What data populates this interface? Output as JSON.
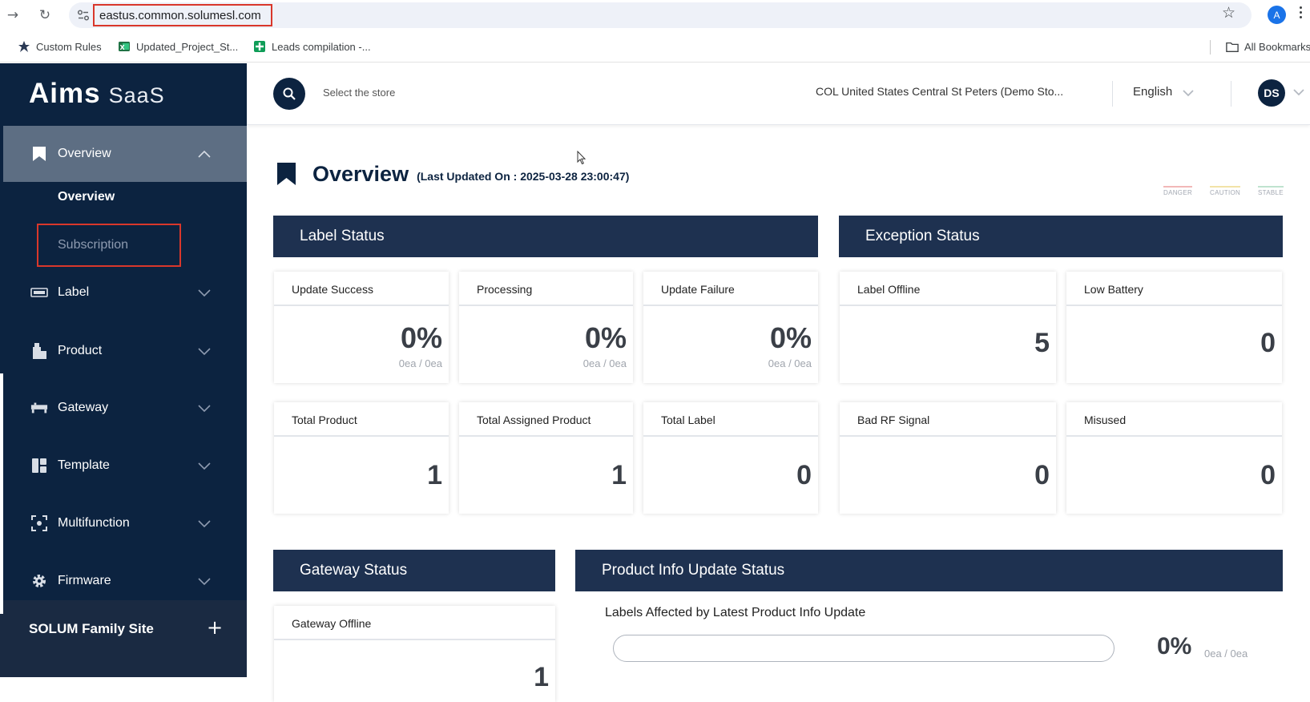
{
  "browser": {
    "url": "eastus.common.solumesl.com",
    "profile_initial": "A",
    "bookmarks": [
      {
        "label": "Custom Rules",
        "icon": "custom-rules-icon"
      },
      {
        "label": "Updated_Project_St...",
        "icon": "excel-icon"
      },
      {
        "label": "Leads compilation -...",
        "icon": "sheets-icon"
      }
    ],
    "all_bookmarks": "All Bookmarks"
  },
  "sidebar": {
    "logo_main": "Aims",
    "logo_sub": "SaaS",
    "overview_label": "Overview",
    "sub_items": [
      "Overview",
      "Subscription"
    ],
    "items": [
      {
        "label": "Label",
        "icon": "label-icon"
      },
      {
        "label": "Product",
        "icon": "product-icon"
      },
      {
        "label": "Gateway",
        "icon": "gateway-icon"
      },
      {
        "label": "Template",
        "icon": "template-icon"
      },
      {
        "label": "Multifunction",
        "icon": "multifunction-icon"
      },
      {
        "label": "Firmware",
        "icon": "gear-icon"
      }
    ],
    "family_site": "SOLUM Family Site",
    "family_plus": "+"
  },
  "header": {
    "store_placeholder": "Select the store",
    "store_name": "COL United States Central St Peters (Demo Sto...",
    "language": "English",
    "user_initials": "DS"
  },
  "page": {
    "title": "Overview",
    "last_updated": "(Last Updated On : 2025-03-28 23:00:47)",
    "legend": [
      {
        "label": "DANGER",
        "color": "#f2b8b8"
      },
      {
        "label": "CAUTION",
        "color": "#f2e3a8"
      },
      {
        "label": "STABLE",
        "color": "#bfe3cf"
      }
    ]
  },
  "label_status": {
    "title": "Label Status",
    "cards": [
      {
        "title": "Update Success",
        "value": "0%",
        "sub": "0ea / 0ea"
      },
      {
        "title": "Processing",
        "value": "0%",
        "sub": "0ea / 0ea"
      },
      {
        "title": "Update Failure",
        "value": "0%",
        "sub": "0ea / 0ea"
      },
      {
        "title": "Total Product",
        "value": "1"
      },
      {
        "title": "Total Assigned Product",
        "value": "1"
      },
      {
        "title": "Total Label",
        "value": "0"
      }
    ]
  },
  "exception_status": {
    "title": "Exception Status",
    "cards": [
      {
        "title": "Label Offline",
        "value": "5"
      },
      {
        "title": "Low Battery",
        "value": "0"
      },
      {
        "title": "Bad RF Signal",
        "value": "0"
      },
      {
        "title": "Misused",
        "value": "0"
      }
    ]
  },
  "gateway_status": {
    "title": "Gateway Status",
    "cards": [
      {
        "title": "Gateway Offline",
        "value": "1"
      }
    ]
  },
  "product_info_update": {
    "title": "Product Info Update Status",
    "subtitle": "Labels Affected by Latest Product Info Update",
    "percent": "0%",
    "progress_fraction": 0,
    "count": "0ea / 0ea"
  }
}
